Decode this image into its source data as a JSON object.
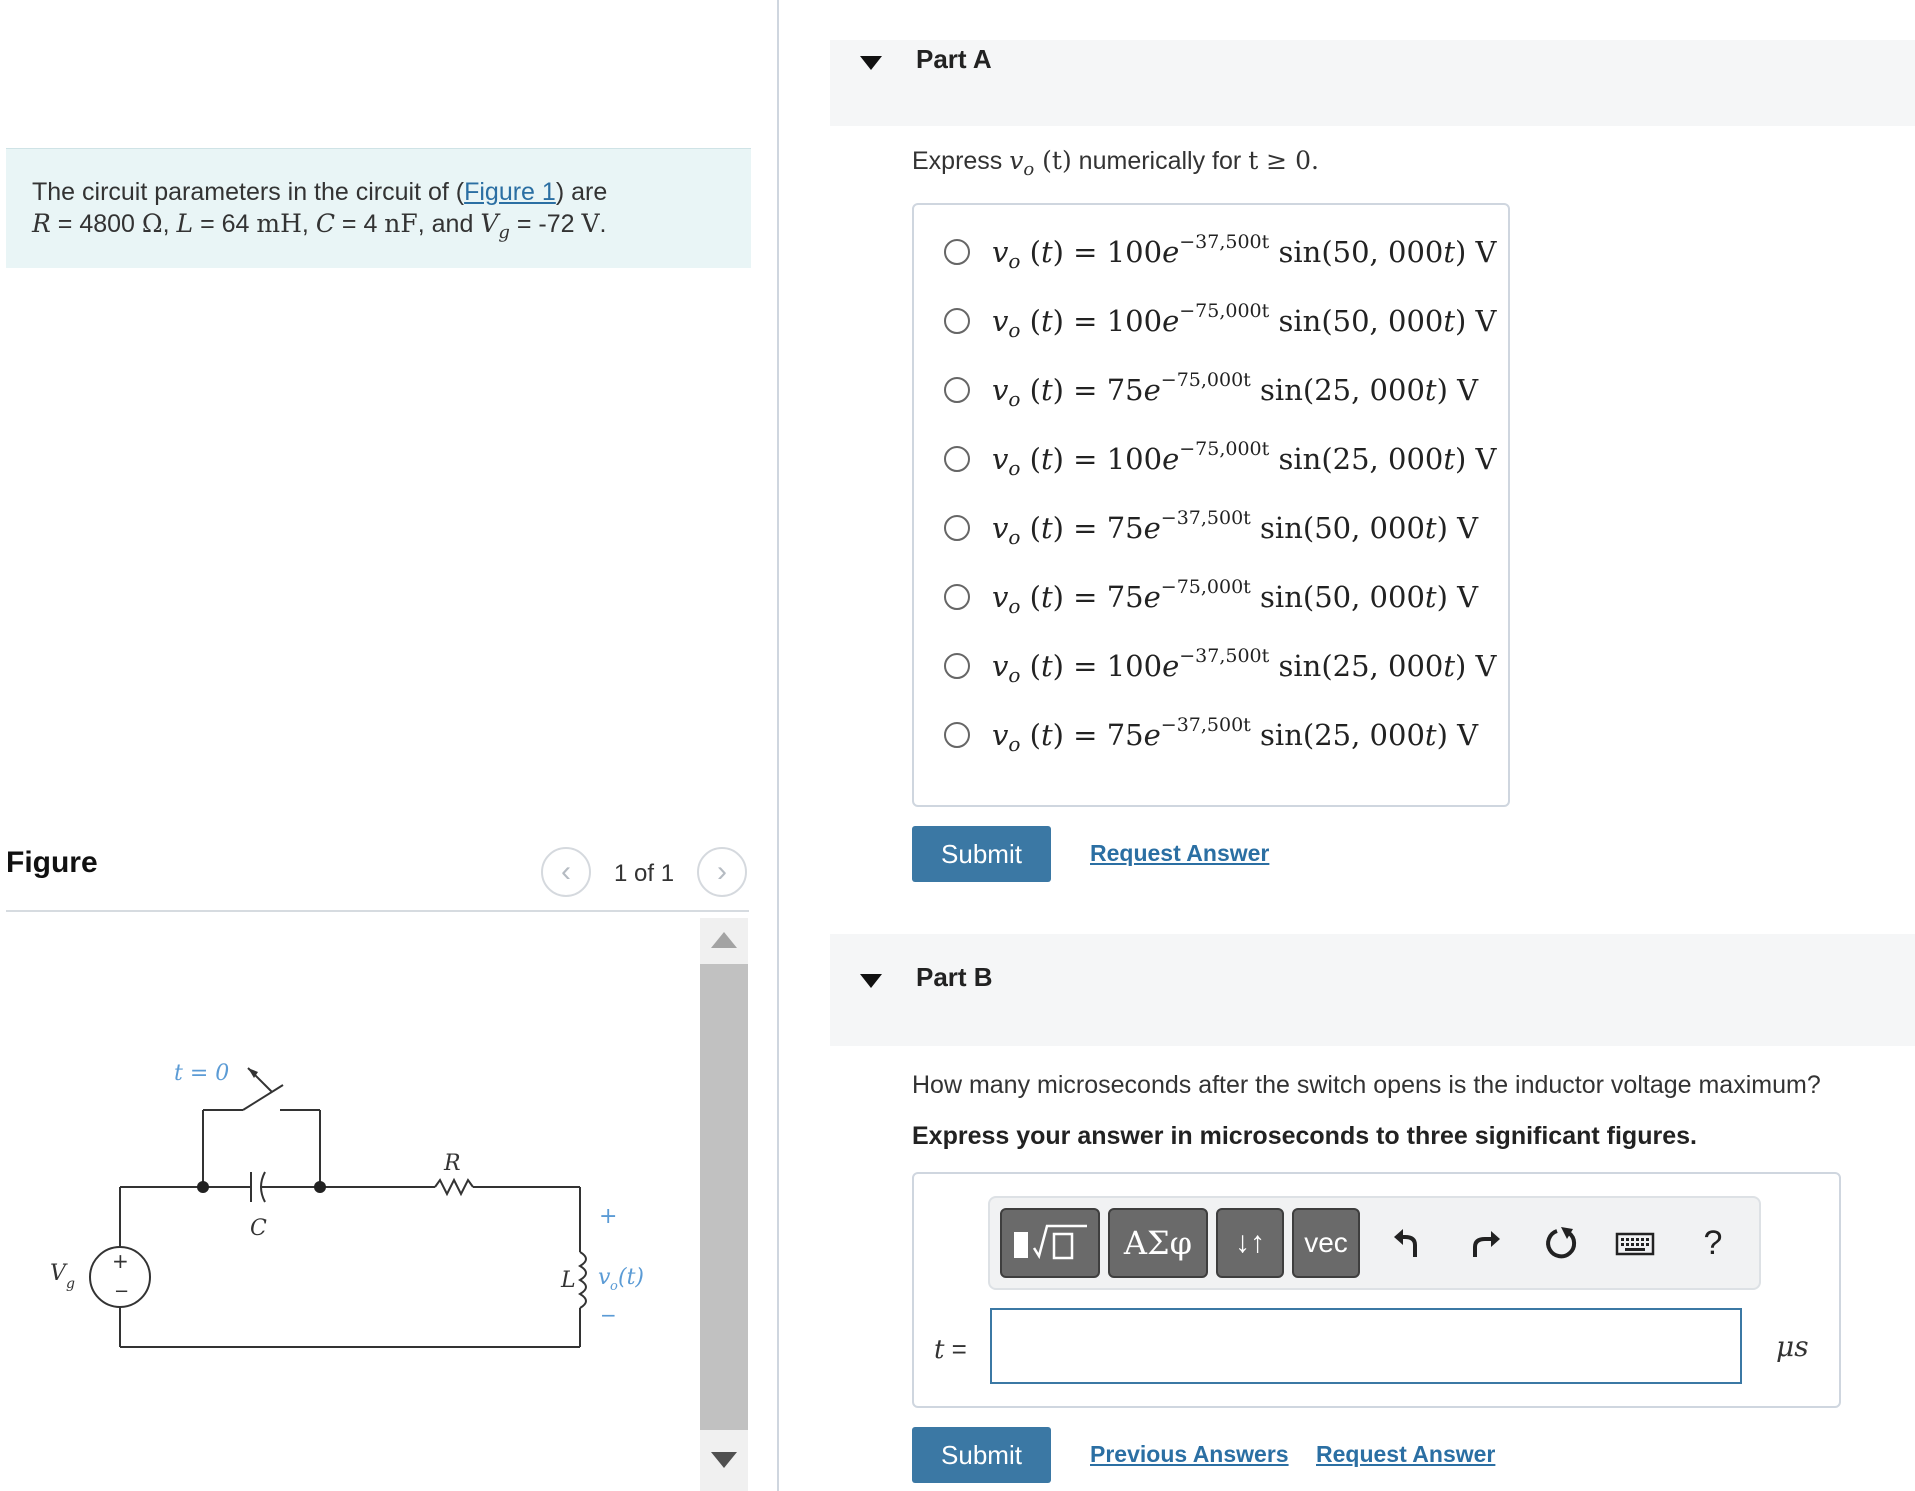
{
  "problem": {
    "intro": "The circuit parameters in the circuit of (",
    "figure_link": "Figure 1",
    "intro_end": ") are",
    "params": [
      {
        "var": "R",
        "eq": " = 4800 ",
        "unit": "Ω",
        "sep": ", "
      },
      {
        "var": "L",
        "eq": " = 64 ",
        "unit": "mH",
        "sep": ", "
      },
      {
        "var": "C",
        "eq": " = 4 ",
        "unit": "nF",
        "sep": ", and "
      },
      {
        "var": "V",
        "sub": "g",
        "eq": " = -72 ",
        "unit": "V",
        "sep": "."
      }
    ]
  },
  "figure": {
    "title": "Figure",
    "counter": "1 of 1",
    "prev_icon": "chevron-left-icon",
    "next_icon": "chevron-right-icon",
    "circuit_labels": {
      "switch": "t = 0",
      "capacitor": "C",
      "resistor": "R",
      "inductor": "L",
      "source": "V",
      "source_sub": "g",
      "output": "v",
      "output_sub": "o",
      "output_arg": "(t)",
      "plus": "+",
      "minus": "−"
    }
  },
  "partA": {
    "title": "Part A",
    "prompt_prefix": "Express ",
    "prompt_var": "v",
    "prompt_sub": "o",
    "prompt_mid": " (t)",
    "prompt_suffix": " numerically for ",
    "prompt_cond": "t ≥ 0.",
    "choices": [
      {
        "coef": "100",
        "exp": "−37,500t",
        "freq": "50, 000"
      },
      {
        "coef": "100",
        "exp": "−75,000t",
        "freq": "50, 000"
      },
      {
        "coef": "75",
        "exp": "−75,000t",
        "freq": "25, 000"
      },
      {
        "coef": "100",
        "exp": "−75,000t",
        "freq": "25, 000"
      },
      {
        "coef": "75",
        "exp": "−37,500t",
        "freq": "50, 000"
      },
      {
        "coef": "75",
        "exp": "−75,000t",
        "freq": "50, 000"
      },
      {
        "coef": "100",
        "exp": "−37,500t",
        "freq": "25, 000"
      },
      {
        "coef": "75",
        "exp": "−37,500t",
        "freq": "25, 000"
      }
    ],
    "submit_label": "Submit",
    "request_label": "Request Answer"
  },
  "partB": {
    "title": "Part B",
    "question": "How many microseconds after the switch opens is the inductor voltage maximum?",
    "instruction": "Express your answer in microseconds to three significant figures.",
    "toolbar": {
      "greek": "ΑΣφ",
      "arrows": "↓↑",
      "vec": "vec",
      "help": "?"
    },
    "var_label": "t",
    "eq_label": " =",
    "input_value": "",
    "unit": "μs",
    "submit_label": "Submit",
    "previous_label": "Previous Answers",
    "request_label": "Request Answer"
  },
  "colors": {
    "accent": "#3b78a4",
    "link": "#2b6fa3",
    "problem_bg": "#e9f5f6",
    "circuit_blue": "#5b9bd5"
  }
}
